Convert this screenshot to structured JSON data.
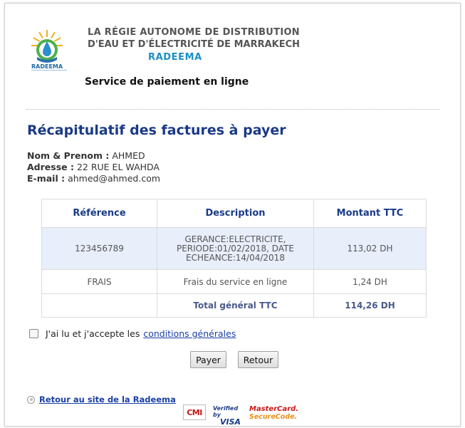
{
  "header": {
    "logo_text": "RADEEMA",
    "org_line1": "LA RÉGIE  AUTONOME   DE  DISTRIBUTION",
    "org_line2": "D'EAU ET D'ÉLECTRICITÉ DE MARRAKECH",
    "org_line3": "RADEEMA",
    "service": "Service de paiement en ligne"
  },
  "main": {
    "title": "Récapitulatif des factures à payer",
    "customer": {
      "name_label": "Nom & Prenom :",
      "name_value": "AHMED",
      "address_label": "Adresse :",
      "address_value": "22 RUE EL WAHDA",
      "email_label": "E-mail :",
      "email_value": "ahmed@ahmed.com"
    }
  },
  "table": {
    "headers": [
      "Référence",
      "Description",
      "Montant TTC"
    ],
    "rows": [
      {
        "reference": "123456789",
        "description": "GERANCE:ELECTRICITE, PERIODE:01/02/2018, DATE ECHEANCE:14/04/2018",
        "amount": "113,02 DH"
      },
      {
        "reference": "FRAIS",
        "description": "Frais du service en ligne",
        "amount": "1,24 DH"
      }
    ],
    "total_label": "Total général TTC",
    "total_value": "114,26 DH"
  },
  "terms": {
    "checked": false,
    "text": "J'ai lu et j'accepte les",
    "link": "conditions générales"
  },
  "buttons": {
    "pay": "Payer",
    "back": "Retour"
  },
  "footer": {
    "back_link": "Retour au site de la Radeema",
    "cmi": "CMI",
    "visa_top": "Verified by",
    "visa_bottom": "VISA",
    "mc_top": "MasterCard.",
    "mc_bottom": "SecureCode."
  },
  "colors": {
    "title": "#1a3a88",
    "org_accent": "#1a8fc6",
    "row_highlight": "#e8eefa",
    "link": "#1a3fa8"
  }
}
